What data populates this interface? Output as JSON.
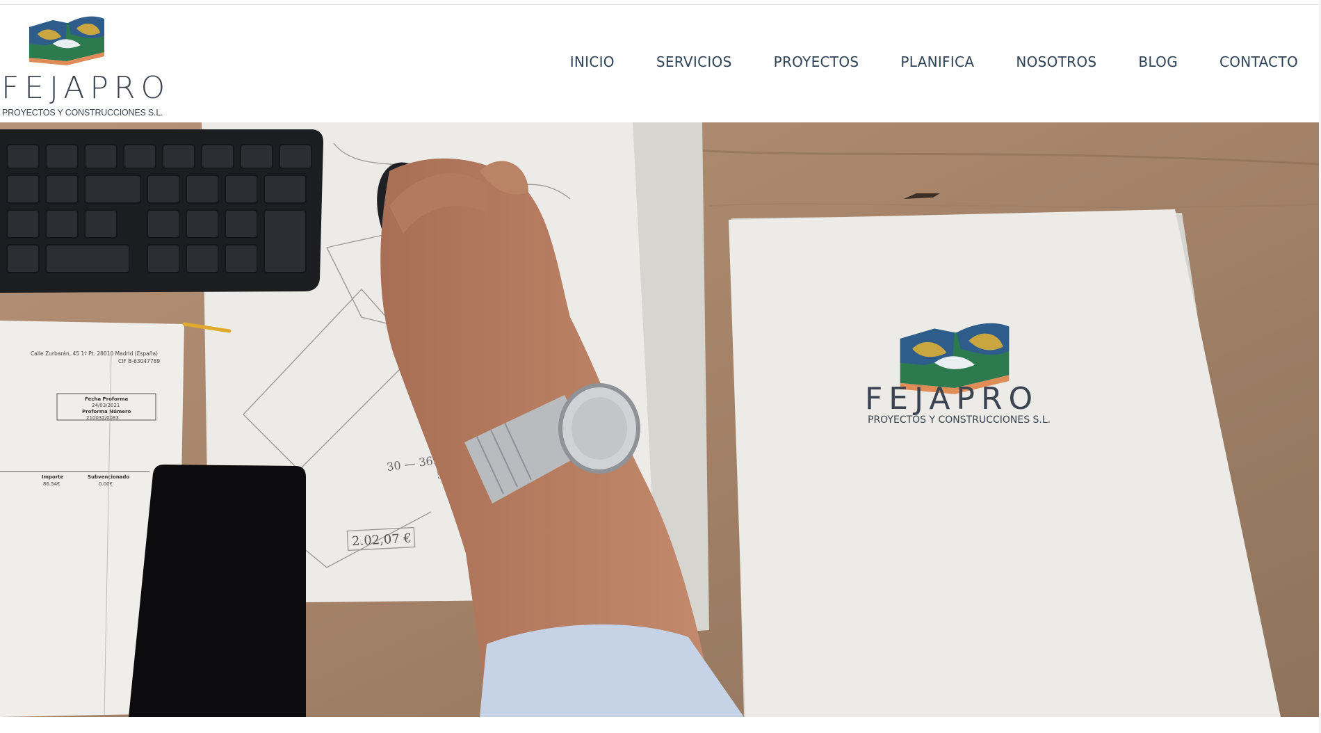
{
  "brand": {
    "name": "FEJAPRO",
    "tagline": "PROYECTOS Y CONSTRUCCIONES S.L."
  },
  "nav": {
    "items": [
      {
        "label": "INICIO"
      },
      {
        "label": "SERVICIOS"
      },
      {
        "label": "PROYECTOS"
      },
      {
        "label": "PLANIFICA"
      },
      {
        "label": "NOSOTROS"
      },
      {
        "label": "BLOG"
      },
      {
        "label": "CONTACTO"
      }
    ]
  },
  "hero": {
    "folder_brand": "FEJAPRO",
    "folder_tagline": "PROYECTOS Y CONSTRUCCIONES S.L.",
    "sketch_price": "2.02,07 €",
    "sketch_dims": "30 — 36.5",
    "sketch_dims2": "52",
    "invoice_address": "Calle Zurbarán, 45 1º Pt. 28010 Madrid (España)",
    "invoice_cif": "CIF B-63047789",
    "invoice_date_label": "Fecha Proforma",
    "invoice_date": "24/03/2021",
    "invoice_number_label": "Proforma Número",
    "invoice_number": "210032/0083",
    "invoice_col1": "Importe",
    "invoice_col2": "Subvencionado",
    "invoice_amount": "86.54€",
    "invoice_sub": "0.00€"
  },
  "colors": {
    "nav_text": "#2f4358",
    "logo_blue": "#2e5d8c",
    "logo_green": "#2d7a4f",
    "logo_gold": "#c9a640",
    "logo_orange": "#e08c56",
    "desk": "#a7876b",
    "folder": "#ecebe7"
  }
}
